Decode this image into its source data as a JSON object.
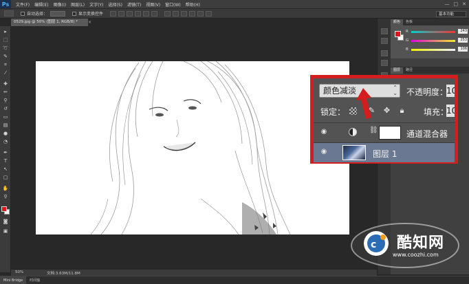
{
  "app": {
    "logo": "Ps",
    "menu": [
      "文件(F)",
      "编辑(E)",
      "图像(I)",
      "图层(L)",
      "文字(Y)",
      "选择(S)",
      "滤镜(T)",
      "视图(V)",
      "窗口(W)",
      "帮助(H)"
    ],
    "window_controls": [
      "—",
      "□",
      "✕"
    ]
  },
  "options_bar": {
    "auto_select_label": "自动选择：",
    "transform_label": "显示变换控件",
    "workspace": "基本功能"
  },
  "document": {
    "tab_title": "0529.jpg @ 50% (图层 1, RGB/8) *",
    "close": "×"
  },
  "color_panel": {
    "tabs": [
      "颜色",
      "色板"
    ],
    "sliders": [
      {
        "letter": "R",
        "value": "243",
        "gradient": "linear-gradient(90deg,#00cfd0,#ff3030)"
      },
      {
        "letter": "G",
        "value": "253",
        "gradient": "linear-gradient(90deg,#e000e0,#f0f020)"
      },
      {
        "letter": "B",
        "value": "106",
        "gradient": "linear-gradient(90deg,#f0f000,#f0f0ff)"
      }
    ],
    "fg_color": "#e3131b",
    "bg_color": "#ffffff"
  },
  "panel2": {
    "tabs": [
      "图层",
      "路径"
    ]
  },
  "layers": {
    "blend_mode": "颜色减淡",
    "opacity_label": "不透明度：",
    "opacity_value": "10",
    "lock_label": "锁定：",
    "fill_label": "填充：",
    "fill_value": "10",
    "rows": [
      {
        "name": "通道混合器",
        "type": "adjustment"
      },
      {
        "name": "图层 1",
        "type": "image",
        "selected": true
      }
    ]
  },
  "status": {
    "zoom": "50%",
    "doc_info": "文档:3.63M/11.8M"
  },
  "bottom_tabs": [
    "Mini Bridge",
    "时间轴"
  ],
  "watermark": {
    "brand": "酷知网",
    "url": "www.coozhi.com"
  },
  "accent_color": "#d51d1d"
}
